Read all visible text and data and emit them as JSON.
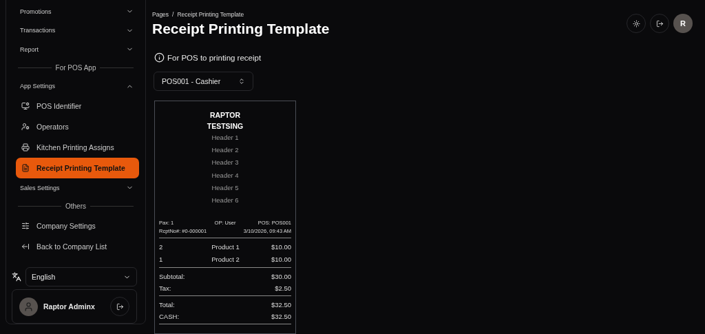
{
  "sidebar": {
    "nav": [
      {
        "kind": "group",
        "label": "Promotions",
        "expanded": false
      },
      {
        "kind": "group",
        "label": "Transactions",
        "expanded": false
      },
      {
        "kind": "group",
        "label": "Report",
        "expanded": false
      },
      {
        "kind": "section",
        "label": "For POS App"
      },
      {
        "kind": "group",
        "label": "App Settings",
        "expanded": true,
        "children": [
          {
            "label": "POS Identifier",
            "selected": false
          },
          {
            "label": "Operators",
            "selected": false
          },
          {
            "label": "Kitchen Printing Assigns",
            "selected": false
          },
          {
            "label": "Receipt Printing Template",
            "selected": true
          }
        ]
      },
      {
        "kind": "group",
        "label": "Sales Settings",
        "expanded": false
      },
      {
        "kind": "section",
        "label": "Others"
      },
      {
        "kind": "link",
        "label": "Company Settings",
        "selected": false
      },
      {
        "kind": "link",
        "label": "Back to Company List",
        "selected": false
      }
    ],
    "language": "English",
    "user": {
      "name": "Raptor Adminx"
    }
  },
  "header": {
    "breadcrumb": {
      "items": [
        "Pages",
        "Receipt Printing Template"
      ],
      "separator": "/"
    },
    "title": "Receipt Printing Template",
    "avatar": "R"
  },
  "info": "For POS to printing receipt",
  "pos_select": "POS001 - Cashier",
  "receipt": {
    "company": [
      "RAPTOR",
      "TESTSING"
    ],
    "headers": [
      "Header 1",
      "Header 2",
      "Header 3",
      "Header 4",
      "Header 5",
      "Header 6"
    ],
    "meta": [
      {
        "left": "Pax: 1",
        "center": "OP: User",
        "right": "POS: POS001"
      },
      {
        "left": "RcptNo#: #0-000001",
        "right": "3/10/2026, 09:43 AM"
      }
    ],
    "items": [
      {
        "qty": "2",
        "name": "Product 1",
        "price": "$10.00"
      },
      {
        "qty": "1",
        "name": "Product 2",
        "price": "$10.00"
      }
    ],
    "totals": [
      [
        {
          "label": "Subtotal:",
          "value": "$30.00"
        },
        {
          "label": "Tax:",
          "value": "$2.50"
        }
      ],
      [
        {
          "label": "Total:",
          "value": "$32.50"
        },
        {
          "label": "CASH:",
          "value": "$32.50"
        }
      ]
    ]
  }
}
